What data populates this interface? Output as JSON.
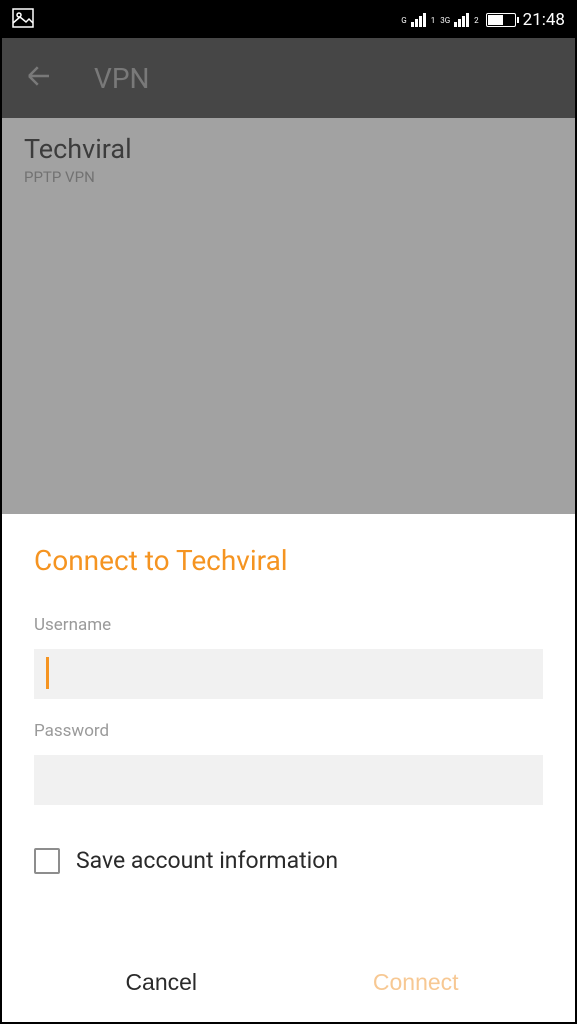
{
  "statusbar": {
    "net1_label": "G",
    "net1_sub": "1",
    "net2_label": "3G",
    "net2_sub": "2",
    "time": "21:48"
  },
  "appbar": {
    "title": "VPN"
  },
  "vpn_entry": {
    "name": "Techviral",
    "subtitle": "PPTP VPN"
  },
  "dialog": {
    "title": "Connect to Techviral",
    "username_label": "Username",
    "username_value": "",
    "password_label": "Password",
    "password_value": "",
    "save_checkbox_label": "Save account information",
    "save_checkbox_checked": false,
    "cancel_label": "Cancel",
    "connect_label": "Connect"
  }
}
